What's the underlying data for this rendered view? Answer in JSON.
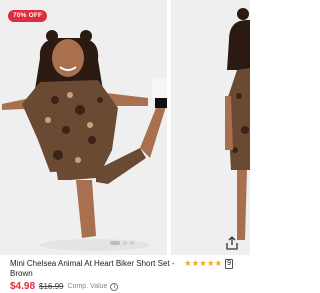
{
  "product": {
    "badge": "70% OFF",
    "title": "Mini Chelsea Animal At Heart Biker Short Set - Brown",
    "sale_price": "$4.98",
    "original_price": "$16.99",
    "comp_value_label": "Comp. Value",
    "rating": 4.5,
    "review_count": "9"
  },
  "carousel": {
    "slides": 3,
    "active_slide": 1
  },
  "icons": {
    "share": "share-icon",
    "info": "info-icon",
    "star": "star-icon"
  },
  "colors": {
    "accent": "#e02d3c",
    "star": "#f5a623",
    "badge_text": "#ffffff"
  }
}
